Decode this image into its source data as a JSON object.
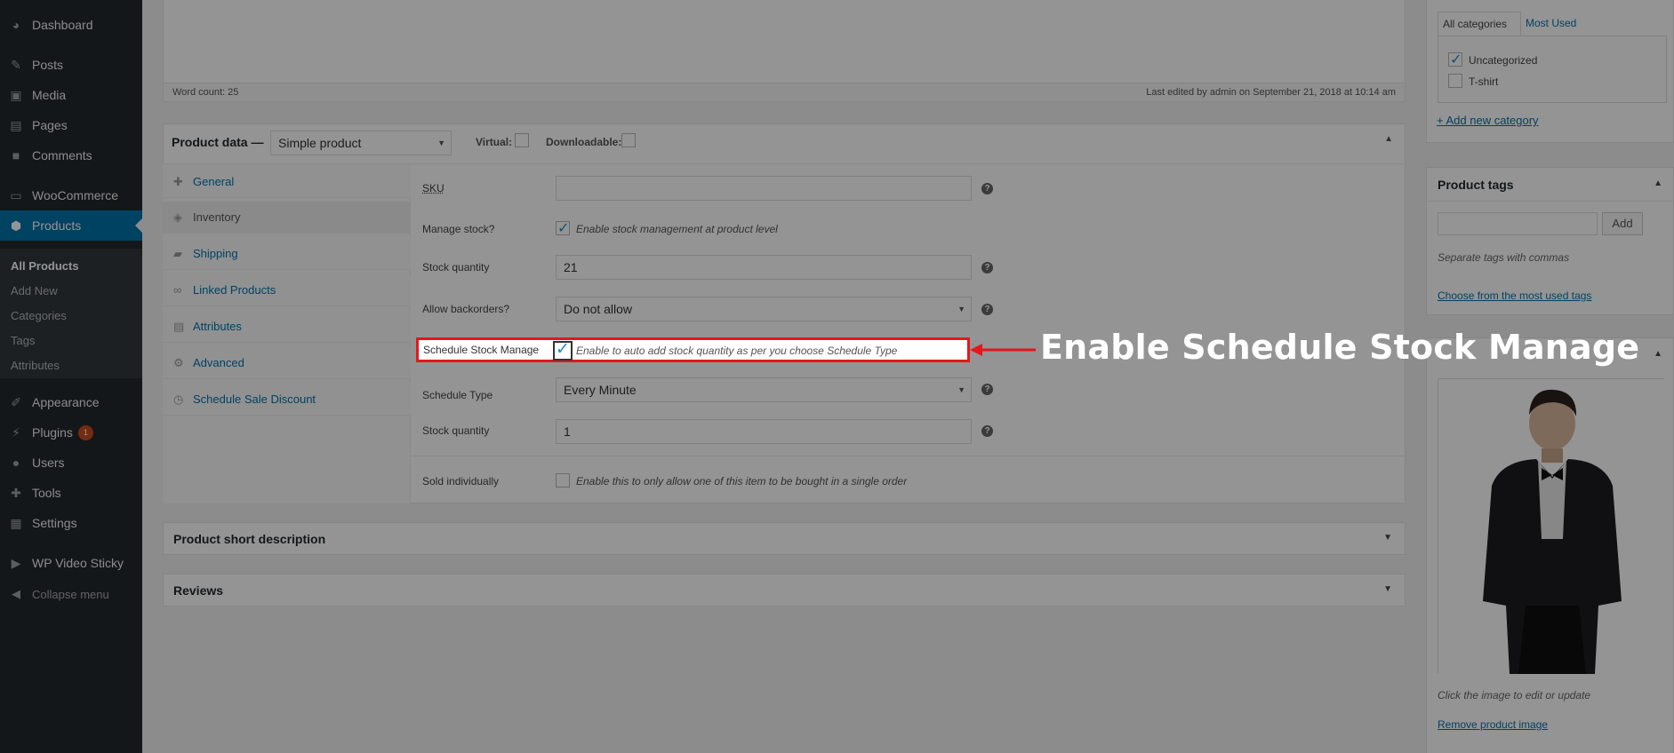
{
  "sidebar": {
    "items": [
      {
        "label": "Dashboard",
        "icon": "dashboard-icon"
      },
      {
        "label": "Posts",
        "icon": "pin-icon"
      },
      {
        "label": "Media",
        "icon": "media-icon"
      },
      {
        "label": "Pages",
        "icon": "page-icon"
      },
      {
        "label": "Comments",
        "icon": "comment-icon"
      },
      {
        "label": "WooCommerce",
        "icon": "woo-icon"
      },
      {
        "label": "Products",
        "icon": "box-icon"
      },
      {
        "label": "Appearance",
        "icon": "brush-icon"
      },
      {
        "label": "Plugins",
        "icon": "plug-icon",
        "badge": "1"
      },
      {
        "label": "Users",
        "icon": "user-icon"
      },
      {
        "label": "Tools",
        "icon": "wrench-icon"
      },
      {
        "label": "Settings",
        "icon": "settings-icon"
      },
      {
        "label": "WP Video Sticky",
        "icon": "video-icon"
      },
      {
        "label": "Collapse menu",
        "icon": "collapse-icon"
      }
    ],
    "submenu": [
      "All Products",
      "Add New",
      "Categories",
      "Tags",
      "Attributes"
    ]
  },
  "editor": {
    "word_count": "Word count: 25",
    "last_edited": "Last edited by admin on September 21, 2018 at 10:14 am"
  },
  "product_data": {
    "title": "Product data —",
    "type_value": "Simple product",
    "virtual_label": "Virtual:",
    "downloadable_label": "Downloadable:",
    "tabs": [
      "General",
      "Inventory",
      "Shipping",
      "Linked Products",
      "Attributes",
      "Advanced",
      "Schedule Sale Discount"
    ],
    "fields": {
      "sku_label": "SKU",
      "manage_stock_label": "Manage stock?",
      "manage_stock_desc": "Enable stock management at product level",
      "stock_qty_label": "Stock quantity",
      "stock_qty_value": "21",
      "backorders_label": "Allow backorders?",
      "backorders_value": "Do not allow",
      "schedule_manage_label": "Schedule Stock Manage",
      "schedule_manage_desc": "Enable to auto add stock quantity as per you choose Schedule Type",
      "schedule_type_label": "Schedule Type",
      "schedule_type_value": "Every Minute",
      "stock_qty2_label": "Stock quantity",
      "stock_qty2_value": "1",
      "sold_individually_label": "Sold individually",
      "sold_individually_desc": "Enable this to only allow one of this item to be bought in a single order",
      "help_glyph": "?"
    }
  },
  "short_description_title": "Product short description",
  "reviews_title": "Reviews",
  "categories": {
    "tab_all": "All categories",
    "tab_most": "Most Used",
    "items": [
      {
        "label": "Uncategorized",
        "checked": true
      },
      {
        "label": "T-shirt",
        "checked": false
      }
    ],
    "add_new": "+ Add new category"
  },
  "tags": {
    "title": "Product tags",
    "add_button": "Add",
    "hint": "Separate tags with commas",
    "choose_link": "Choose from the most used tags"
  },
  "image_box": {
    "caption": "Click the image to edit or update",
    "remove_link": "Remove product image"
  },
  "annotation": "Enable Schedule Stock Manage"
}
